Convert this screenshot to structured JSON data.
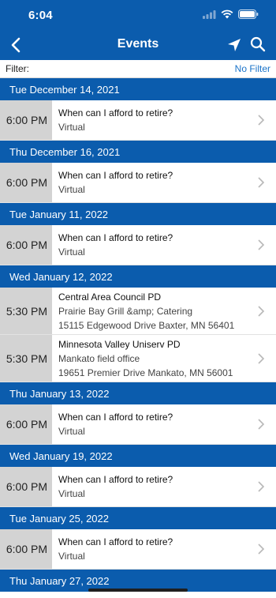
{
  "status": {
    "time": "6:04"
  },
  "nav": {
    "title": "Events"
  },
  "filter": {
    "label": "Filter:",
    "value": "No Filter"
  },
  "days": [
    {
      "date": "Tue December 14, 2021",
      "events": [
        {
          "time": "6:00 PM",
          "title": "When can I afford to retire?",
          "lines": [
            "Virtual"
          ]
        }
      ]
    },
    {
      "date": "Thu December 16, 2021",
      "events": [
        {
          "time": "6:00 PM",
          "title": "When can I afford to retire?",
          "lines": [
            "Virtual"
          ]
        }
      ]
    },
    {
      "date": "Tue January 11, 2022",
      "events": [
        {
          "time": "6:00 PM",
          "title": "When can I afford to retire?",
          "lines": [
            "Virtual"
          ]
        }
      ]
    },
    {
      "date": "Wed January 12, 2022",
      "events": [
        {
          "time": "5:30 PM",
          "title": "Central Area Council PD",
          "lines": [
            "Prairie Bay Grill &amp; Catering",
            "15115 Edgewood Drive Baxter, MN 56401"
          ]
        },
        {
          "time": "5:30 PM",
          "title": "Minnesota Valley Uniserv PD",
          "lines": [
            "Mankato field office",
            "19651 Premier Drive Mankato, MN 56001"
          ]
        }
      ]
    },
    {
      "date": "Thu January 13, 2022",
      "events": [
        {
          "time": "6:00 PM",
          "title": "When can I afford to retire?",
          "lines": [
            "Virtual"
          ]
        }
      ]
    },
    {
      "date": "Wed January 19, 2022",
      "events": [
        {
          "time": "6:00 PM",
          "title": "When can I afford to retire?",
          "lines": [
            "Virtual"
          ]
        }
      ]
    },
    {
      "date": "Tue January 25, 2022",
      "events": [
        {
          "time": "6:00 PM",
          "title": "When can I afford to retire?",
          "lines": [
            "Virtual"
          ]
        }
      ]
    },
    {
      "date": "Thu January 27, 2022",
      "events": []
    }
  ],
  "colors": {
    "accent": "#0b5cad",
    "time_cell": "#d3d3d3",
    "link": "#1a73c9"
  },
  "icons": [
    "back-arrow-icon",
    "location-arrow-icon",
    "search-icon",
    "chevron-right-icon",
    "wifi-icon",
    "battery-icon",
    "signal-icon"
  ]
}
